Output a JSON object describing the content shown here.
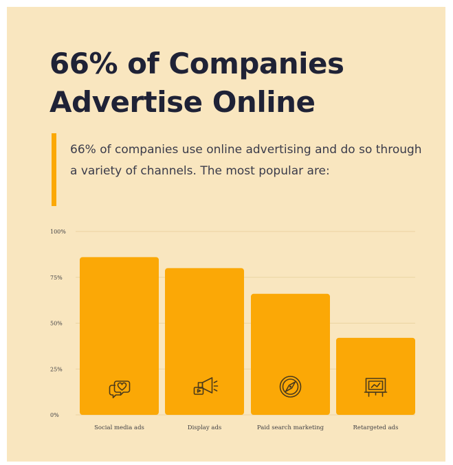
{
  "infographic": {
    "title_line1": "66% of Companies",
    "title_line2": "Advertise Online",
    "intro": "66% of companies use online advertising and do so through a variety of channels. The most popular are:"
  },
  "colors": {
    "background": "#f9e6bf",
    "bar": "#fba806",
    "title": "#1f2236",
    "icon": "#4a3a1c"
  },
  "chart_data": {
    "type": "bar",
    "categories": [
      "Social media ads",
      "Display ads",
      "Paid search marketing",
      "Retargeted ads"
    ],
    "values": [
      86,
      80,
      66,
      42
    ],
    "icons": [
      "chat-heart-icon",
      "megaphone-icon",
      "compass-icon",
      "presentation-board-icon"
    ],
    "yticks": [
      "0%",
      "25%",
      "50%",
      "75%",
      "100%"
    ],
    "ylim": [
      0,
      100
    ],
    "grid": true
  }
}
